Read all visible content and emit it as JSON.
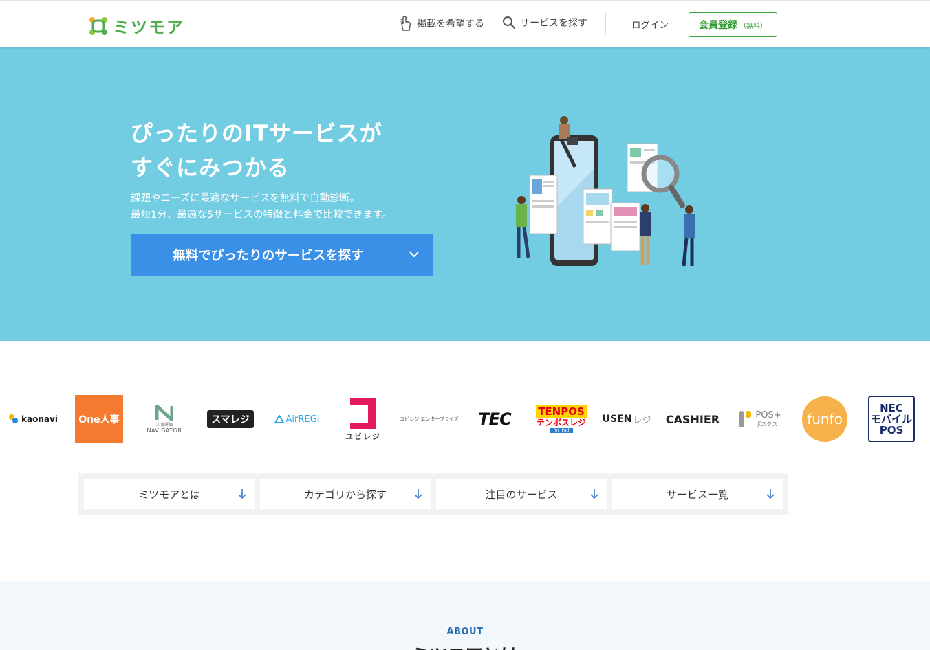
{
  "brand": {
    "name": "ミツモア",
    "color": "#4cae4c"
  },
  "header": {
    "nav_publish": "掲載を希望する",
    "nav_search": "サービスを探す",
    "nav_login": "ログイン",
    "register_label": "会員登録",
    "register_note": "（無料）"
  },
  "hero": {
    "title_line1": "ぴったりのITサービスが",
    "title_line2": "すぐにみつかる",
    "desc_line1": "課題やニーズに最適なサービスを無料で自動診断。",
    "desc_line2": "最短1分、最適な5サービスの特徴と料金で比較できます。",
    "cta_label": "無料でぴったりのサービスを探す",
    "bg_color": "#72cde2",
    "cta_color": "#3a8fe6"
  },
  "logos": [
    {
      "text": "kaonavi",
      "icon": "kaonavi-mark-icon"
    },
    {
      "text": "One人事"
    },
    {
      "text": "人事評価",
      "sub": "NAVIGATOR"
    },
    {
      "text": "スマレジ"
    },
    {
      "text": "AirREGI"
    },
    {
      "text": "ユビレジ"
    },
    {
      "text": "ユビレジ エンタープライズ"
    },
    {
      "text": "TEC"
    },
    {
      "text": "TENPOS",
      "sub": "テンポスレジ",
      "sub2": "for iPad"
    },
    {
      "text": "USEN",
      "sub": "レジ"
    },
    {
      "text": "CASHIER"
    },
    {
      "text": "POS+",
      "sub": "ポスタス"
    },
    {
      "text": "funfo"
    },
    {
      "text": "NEC",
      "sub": "モバイル",
      "sub2": "POS"
    }
  ],
  "anchors": [
    {
      "label": "ミツモアとは"
    },
    {
      "label": "カテゴリから探す"
    },
    {
      "label": "注目のサービス"
    },
    {
      "label": "サービス一覧"
    }
  ],
  "about": {
    "label": "ABOUT",
    "title": "ミツモアとは"
  }
}
